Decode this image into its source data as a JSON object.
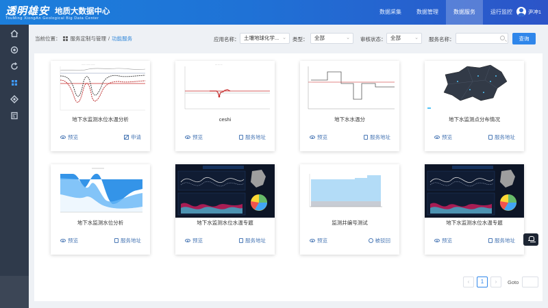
{
  "header": {
    "logo_cn": "透明雄安",
    "logo_en": "TouMing XiongAn Geological Big Data Center",
    "title": "地质大数据中心",
    "nav": [
      {
        "label": "数据采集"
      },
      {
        "label": "数据管理"
      },
      {
        "label": "数据服务"
      },
      {
        "label": "运行监控"
      }
    ],
    "active_nav": "数据服务",
    "user_name": "尹冲1"
  },
  "sidebar": {
    "icons": [
      "home-icon",
      "target-icon",
      "refresh-icon",
      "grid-icon",
      "compass-icon",
      "report-icon"
    ],
    "active": "grid-icon"
  },
  "breadcrumb": {
    "prefix": "当前位置：",
    "parent": "服务定制与管理",
    "separator": "/",
    "current": "功能服务"
  },
  "filters": {
    "app_label": "应用名称：",
    "app_value": "土壤地球化学...",
    "type_label": "类型：",
    "type_value": "全部",
    "status_label": "审核状态：",
    "status_value": "全部",
    "service_label": "服务名称：",
    "service_value": "",
    "query_label": "查询"
  },
  "actions": {
    "preview": "预览",
    "apply": "申请",
    "address": "服务地址",
    "rejected": "被驳回"
  },
  "cards": [
    {
      "title": "地下水监测水位水温分析",
      "thumb": "line-multi",
      "right_action": "申请",
      "right_icon": "edit-icon"
    },
    {
      "title": "ceshi",
      "thumb": "line-flat",
      "right_action": "服务地址",
      "right_icon": "document-icon"
    },
    {
      "title": "地下水水温分",
      "thumb": "step",
      "right_action": "服务地址",
      "right_icon": "document-icon"
    },
    {
      "title": "地下水监测点分布情况",
      "thumb": "map-dark",
      "right_action": "服务地址",
      "right_icon": "document-icon"
    },
    {
      "title": "地下水监测水位分析",
      "thumb": "area-blue",
      "right_action": "服务地址",
      "right_icon": "document-icon"
    },
    {
      "title": "地下水监测水位水温专题",
      "thumb": "dashboard-dark",
      "right_action": "服务地址",
      "right_icon": "document-icon"
    },
    {
      "title": "监测井编号测试",
      "thumb": "bar-light",
      "right_action": "被驳回",
      "right_icon": "reject-icon"
    },
    {
      "title": "地下水监测水位水温专题",
      "thumb": "dashboard-dark",
      "right_action": "服务地址",
      "right_icon": "document-icon"
    }
  ],
  "pagination": {
    "prev": "‹",
    "page": "1",
    "next": "›",
    "goto_label": "Goto"
  },
  "colors": {
    "header_start": "#1c7fdc",
    "header_end": "#2c54c8",
    "sidebar": "#2f3a4b",
    "accent": "#2f86ea",
    "link": "#4a78b5"
  }
}
